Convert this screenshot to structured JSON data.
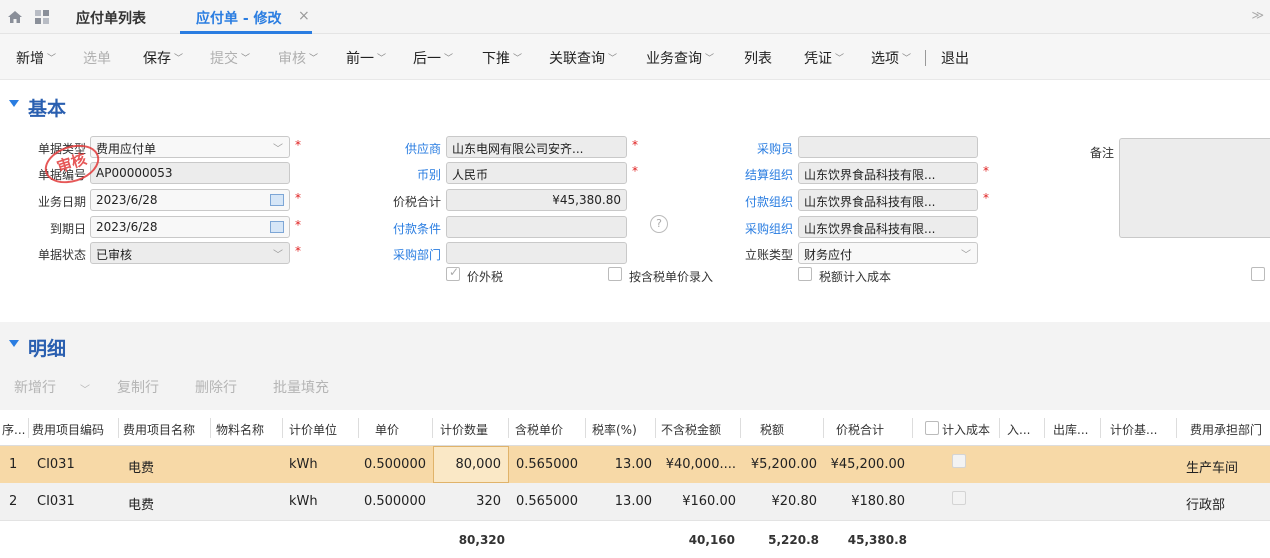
{
  "tabs": {
    "list_tab": "应付单列表",
    "active_tab": "应付单 - 修改",
    "close_glyph": "×"
  },
  "toolbar": [
    {
      "label": "新增",
      "caret": true,
      "disabled": false
    },
    {
      "label": "选单",
      "caret": false,
      "disabled": true
    },
    {
      "label": "保存",
      "caret": true,
      "disabled": false
    },
    {
      "label": "提交",
      "caret": true,
      "disabled": true
    },
    {
      "label": "审核",
      "caret": true,
      "disabled": true
    },
    {
      "label": "前一",
      "caret": true,
      "disabled": false
    },
    {
      "label": "后一",
      "caret": true,
      "disabled": false
    },
    {
      "label": "下推",
      "caret": true,
      "disabled": false
    },
    {
      "label": "关联查询",
      "caret": true,
      "disabled": false
    },
    {
      "label": "业务查询",
      "caret": true,
      "disabled": false
    },
    {
      "label": "列表",
      "caret": false,
      "disabled": false
    },
    {
      "label": "凭证",
      "caret": true,
      "disabled": false
    },
    {
      "label": "选项",
      "caret": true,
      "disabled": false
    },
    {
      "label": "退出",
      "caret": false,
      "disabled": false
    }
  ],
  "basic": {
    "title": "基本",
    "stamp": "审核",
    "doc_type": {
      "label": "单据类型",
      "value": "费用应付单"
    },
    "doc_no": {
      "label": "单据编号",
      "value": "AP00000053"
    },
    "biz_date": {
      "label": "业务日期",
      "value": "2023/6/28"
    },
    "due_date": {
      "label": "到期日",
      "value": "2023/6/28"
    },
    "doc_status": {
      "label": "单据状态",
      "value": "已审核"
    },
    "supplier": {
      "label": "供应商",
      "value": "山东电网有限公司安齐..."
    },
    "currency": {
      "label": "币别",
      "value": "人民币"
    },
    "total_tax": {
      "label": "价税合计",
      "value": "¥45,380.80"
    },
    "pay_terms": {
      "label": "付款条件",
      "value": ""
    },
    "purchase_dept": {
      "label": "采购部门",
      "value": ""
    },
    "tax_excl": {
      "label": "价外税",
      "checked": true
    },
    "price_incl_tax": {
      "label": "按含税单价录入",
      "checked": false
    },
    "buyer": {
      "label": "采购员",
      "value": ""
    },
    "settle_org": {
      "label": "结算组织",
      "value": "山东饮界食品科技有限..."
    },
    "pay_org": {
      "label": "付款组织",
      "value": "山东饮界食品科技有限..."
    },
    "purchase_org": {
      "label": "采购组织",
      "value": "山东饮界食品科技有限..."
    },
    "account_type": {
      "label": "立账类型",
      "value": "财务应付"
    },
    "tax_cost": {
      "label": "税额计入成本",
      "checked": false
    },
    "remark": {
      "label": "备注",
      "value": ""
    },
    "help_glyph": "?"
  },
  "detail": {
    "title": "明细",
    "actions": [
      "新增行",
      "复制行",
      "删除行",
      "批量填充"
    ],
    "columns": [
      "序...",
      "费用项目编码",
      "费用项目名称",
      "物料名称",
      "计价单位",
      "单价",
      "计价数量",
      "含税单价",
      "税率(%)",
      "不含税金额",
      "税额",
      "价税合计",
      "计入成本",
      "入...",
      "出库...",
      "计价基...",
      "费用承担部门"
    ],
    "rows": [
      {
        "seq": "1",
        "code": "CI031",
        "name": "电费",
        "material": "",
        "unit": "kWh",
        "price": "0.500000",
        "qty": "80,000",
        "price_tax": "0.565000",
        "rate": "13.00",
        "amount": "¥40,000....",
        "tax": "¥5,200.00",
        "total": "¥45,200.00",
        "dept": "生产车间"
      },
      {
        "seq": "2",
        "code": "CI031",
        "name": "电费",
        "material": "",
        "unit": "kWh",
        "price": "0.500000",
        "qty": "320",
        "price_tax": "0.565000",
        "rate": "13.00",
        "amount": "¥160.00",
        "tax": "¥20.80",
        "total": "¥180.80",
        "dept": "行政部"
      }
    ],
    "totals": {
      "qty": "80,320",
      "amount": "40,160",
      "tax": "5,220.8",
      "total": "45,380.8"
    }
  }
}
